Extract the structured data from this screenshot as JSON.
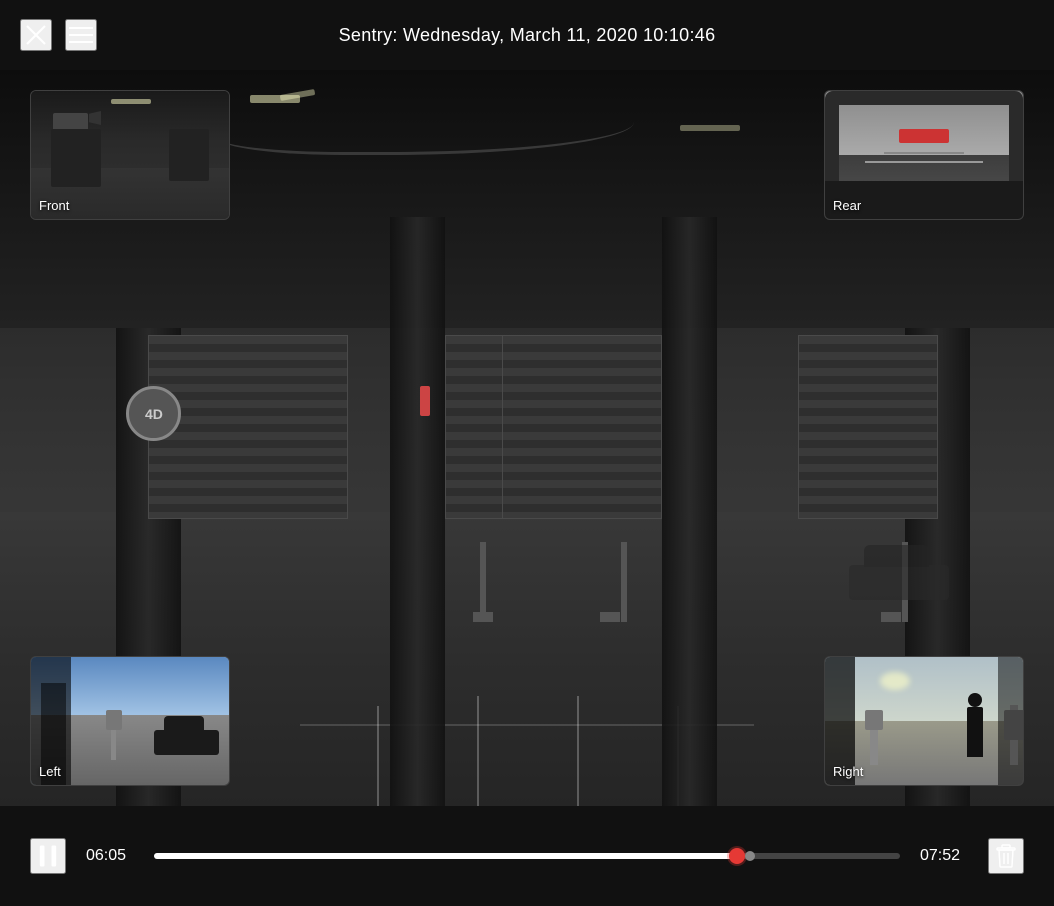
{
  "header": {
    "title": "Sentry: Wednesday, March 11, 2020 10:10:46",
    "close_label": "✕",
    "menu_label": "☰"
  },
  "thumbnails": {
    "front": {
      "label": "Front"
    },
    "rear": {
      "label": "Rear"
    },
    "left": {
      "label": "Left"
    },
    "right": {
      "label": "Right"
    }
  },
  "controls": {
    "current_time": "06:05",
    "total_time": "07:52",
    "progress_percent": 79
  },
  "colors": {
    "accent_red": "#e53935",
    "background": "#111111",
    "header_bg": "#111111",
    "controls_bg": "#111111"
  }
}
